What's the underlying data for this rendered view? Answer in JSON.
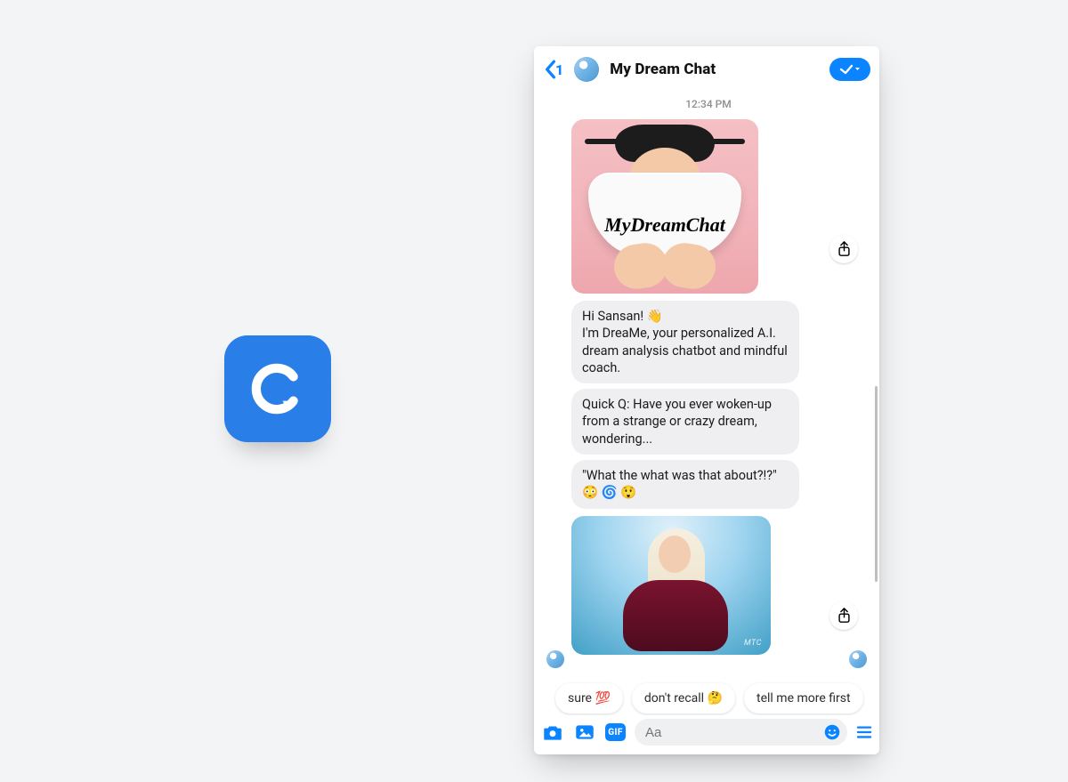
{
  "app_icon": {
    "letter": "C"
  },
  "header": {
    "unread": "1",
    "title": "My Dream Chat"
  },
  "timestamp": "12:34 PM",
  "promo": {
    "label": "MyDreamChat",
    "watermark": ""
  },
  "messages": {
    "m1": "Hi Sansan! 👋\nI'm DreaMe, your personalized A.I. dream analysis chatbot and mindful coach.",
    "m2": "Quick Q: Have you ever woken-up from a strange or crazy dream, wondering...",
    "m3": "\"What the what was that about?!?\" 😳 🌀 😲"
  },
  "gif": {
    "watermark": "MTC"
  },
  "quick_replies": {
    "qr1": "sure 💯",
    "qr2": "don't recall 🤔",
    "qr3": "tell me more first"
  },
  "composer": {
    "gif_label": "GIF",
    "placeholder": "Aa"
  }
}
